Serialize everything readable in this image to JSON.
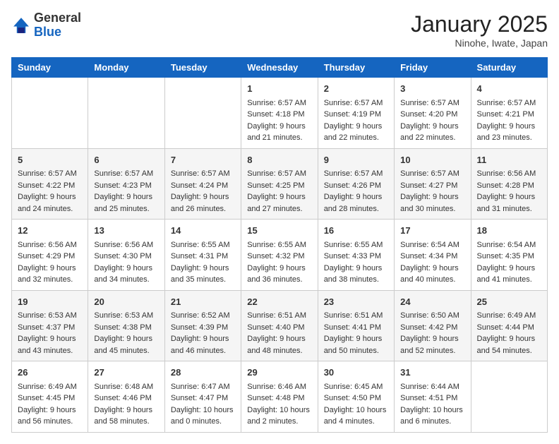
{
  "header": {
    "logo_line1": "General",
    "logo_line2": "Blue",
    "title": "January 2025",
    "subtitle": "Ninohe, Iwate, Japan"
  },
  "days_of_week": [
    "Sunday",
    "Monday",
    "Tuesday",
    "Wednesday",
    "Thursday",
    "Friday",
    "Saturday"
  ],
  "weeks": [
    [
      {
        "day": "",
        "text": ""
      },
      {
        "day": "",
        "text": ""
      },
      {
        "day": "",
        "text": ""
      },
      {
        "day": "1",
        "text": "Sunrise: 6:57 AM\nSunset: 4:18 PM\nDaylight: 9 hours and 21 minutes."
      },
      {
        "day": "2",
        "text": "Sunrise: 6:57 AM\nSunset: 4:19 PM\nDaylight: 9 hours and 22 minutes."
      },
      {
        "day": "3",
        "text": "Sunrise: 6:57 AM\nSunset: 4:20 PM\nDaylight: 9 hours and 22 minutes."
      },
      {
        "day": "4",
        "text": "Sunrise: 6:57 AM\nSunset: 4:21 PM\nDaylight: 9 hours and 23 minutes."
      }
    ],
    [
      {
        "day": "5",
        "text": "Sunrise: 6:57 AM\nSunset: 4:22 PM\nDaylight: 9 hours and 24 minutes."
      },
      {
        "day": "6",
        "text": "Sunrise: 6:57 AM\nSunset: 4:23 PM\nDaylight: 9 hours and 25 minutes."
      },
      {
        "day": "7",
        "text": "Sunrise: 6:57 AM\nSunset: 4:24 PM\nDaylight: 9 hours and 26 minutes."
      },
      {
        "day": "8",
        "text": "Sunrise: 6:57 AM\nSunset: 4:25 PM\nDaylight: 9 hours and 27 minutes."
      },
      {
        "day": "9",
        "text": "Sunrise: 6:57 AM\nSunset: 4:26 PM\nDaylight: 9 hours and 28 minutes."
      },
      {
        "day": "10",
        "text": "Sunrise: 6:57 AM\nSunset: 4:27 PM\nDaylight: 9 hours and 30 minutes."
      },
      {
        "day": "11",
        "text": "Sunrise: 6:56 AM\nSunset: 4:28 PM\nDaylight: 9 hours and 31 minutes."
      }
    ],
    [
      {
        "day": "12",
        "text": "Sunrise: 6:56 AM\nSunset: 4:29 PM\nDaylight: 9 hours and 32 minutes."
      },
      {
        "day": "13",
        "text": "Sunrise: 6:56 AM\nSunset: 4:30 PM\nDaylight: 9 hours and 34 minutes."
      },
      {
        "day": "14",
        "text": "Sunrise: 6:55 AM\nSunset: 4:31 PM\nDaylight: 9 hours and 35 minutes."
      },
      {
        "day": "15",
        "text": "Sunrise: 6:55 AM\nSunset: 4:32 PM\nDaylight: 9 hours and 36 minutes."
      },
      {
        "day": "16",
        "text": "Sunrise: 6:55 AM\nSunset: 4:33 PM\nDaylight: 9 hours and 38 minutes."
      },
      {
        "day": "17",
        "text": "Sunrise: 6:54 AM\nSunset: 4:34 PM\nDaylight: 9 hours and 40 minutes."
      },
      {
        "day": "18",
        "text": "Sunrise: 6:54 AM\nSunset: 4:35 PM\nDaylight: 9 hours and 41 minutes."
      }
    ],
    [
      {
        "day": "19",
        "text": "Sunrise: 6:53 AM\nSunset: 4:37 PM\nDaylight: 9 hours and 43 minutes."
      },
      {
        "day": "20",
        "text": "Sunrise: 6:53 AM\nSunset: 4:38 PM\nDaylight: 9 hours and 45 minutes."
      },
      {
        "day": "21",
        "text": "Sunrise: 6:52 AM\nSunset: 4:39 PM\nDaylight: 9 hours and 46 minutes."
      },
      {
        "day": "22",
        "text": "Sunrise: 6:51 AM\nSunset: 4:40 PM\nDaylight: 9 hours and 48 minutes."
      },
      {
        "day": "23",
        "text": "Sunrise: 6:51 AM\nSunset: 4:41 PM\nDaylight: 9 hours and 50 minutes."
      },
      {
        "day": "24",
        "text": "Sunrise: 6:50 AM\nSunset: 4:42 PM\nDaylight: 9 hours and 52 minutes."
      },
      {
        "day": "25",
        "text": "Sunrise: 6:49 AM\nSunset: 4:44 PM\nDaylight: 9 hours and 54 minutes."
      }
    ],
    [
      {
        "day": "26",
        "text": "Sunrise: 6:49 AM\nSunset: 4:45 PM\nDaylight: 9 hours and 56 minutes."
      },
      {
        "day": "27",
        "text": "Sunrise: 6:48 AM\nSunset: 4:46 PM\nDaylight: 9 hours and 58 minutes."
      },
      {
        "day": "28",
        "text": "Sunrise: 6:47 AM\nSunset: 4:47 PM\nDaylight: 10 hours and 0 minutes."
      },
      {
        "day": "29",
        "text": "Sunrise: 6:46 AM\nSunset: 4:48 PM\nDaylight: 10 hours and 2 minutes."
      },
      {
        "day": "30",
        "text": "Sunrise: 6:45 AM\nSunset: 4:50 PM\nDaylight: 10 hours and 4 minutes."
      },
      {
        "day": "31",
        "text": "Sunrise: 6:44 AM\nSunset: 4:51 PM\nDaylight: 10 hours and 6 minutes."
      },
      {
        "day": "",
        "text": ""
      }
    ]
  ]
}
